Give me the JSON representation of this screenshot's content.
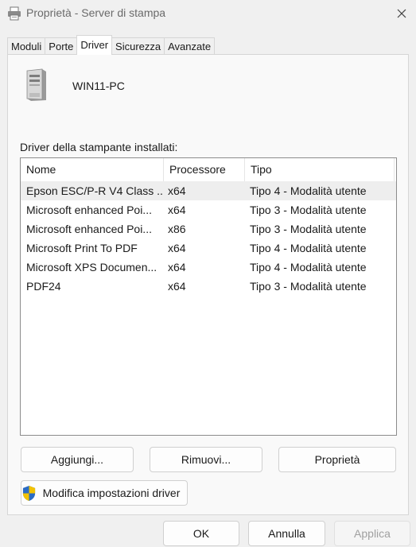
{
  "window": {
    "title": "Proprietà - Server di stampa",
    "title_icon": "printer-icon",
    "close_icon": "close-icon"
  },
  "tabs": [
    {
      "label": "Moduli",
      "active": false
    },
    {
      "label": "Porte",
      "active": false
    },
    {
      "label": "Driver",
      "active": true
    },
    {
      "label": "Sicurezza",
      "active": false
    },
    {
      "label": "Avanzate",
      "active": false
    }
  ],
  "server": {
    "name": "WIN11-PC",
    "icon": "server-tower-icon"
  },
  "drivers": {
    "label": "Driver della stampante installati:",
    "columns": [
      "Nome",
      "Processore",
      "Tipo"
    ],
    "rows": [
      {
        "name": "Epson ESC/P-R V4 Class ...",
        "processor": "x64",
        "type": "Tipo 4 - Modalità utente",
        "selected": true
      },
      {
        "name": "Microsoft enhanced Poi...",
        "processor": "x64",
        "type": "Tipo 3 - Modalità utente",
        "selected": false
      },
      {
        "name": "Microsoft enhanced Poi...",
        "processor": "x86",
        "type": "Tipo 3 - Modalità utente",
        "selected": false
      },
      {
        "name": "Microsoft Print To PDF",
        "processor": "x64",
        "type": "Tipo 4 - Modalità utente",
        "selected": false
      },
      {
        "name": "Microsoft XPS Documen...",
        "processor": "x64",
        "type": "Tipo 4 - Modalità utente",
        "selected": false
      },
      {
        "name": "PDF24",
        "processor": "x64",
        "type": "Tipo 3 - Modalità utente",
        "selected": false
      }
    ]
  },
  "actions": {
    "add": "Aggiungi...",
    "remove": "Rimuovi...",
    "properties": "Proprietà",
    "change_settings": "Modifica impostazioni driver",
    "change_settings_icon": "uac-shield-icon"
  },
  "footer": {
    "ok": "OK",
    "cancel": "Annulla",
    "apply": "Applica",
    "apply_enabled": false
  }
}
